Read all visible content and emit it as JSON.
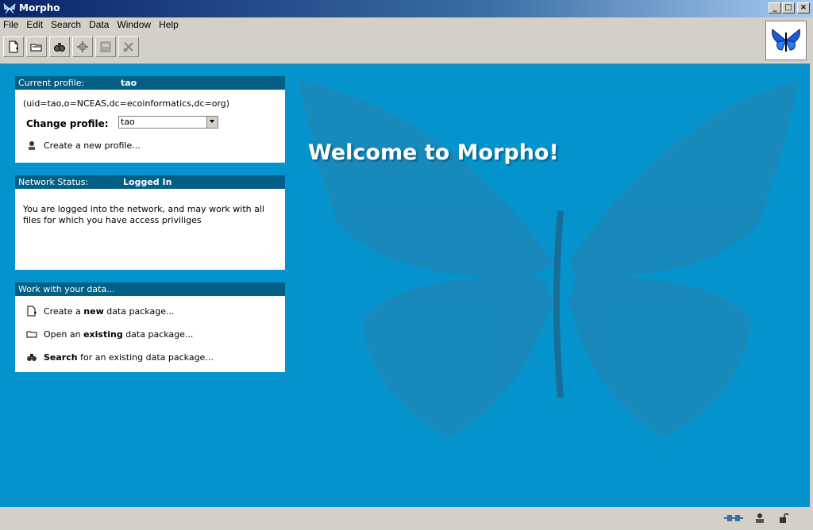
{
  "window": {
    "title": "Morpho"
  },
  "menu": [
    "File",
    "Edit",
    "Search",
    "Data",
    "Window",
    "Help"
  ],
  "toolbar": {
    "icons": [
      "new-package-icon",
      "open-package-icon",
      "search-icon",
      "settings-icon",
      "save-icon",
      "close-package-icon"
    ]
  },
  "welcome": "Welcome to Morpho!",
  "profile": {
    "header_label": "Current profile:",
    "header_value": "tao",
    "dn": "(uid=tao,o=NCEAS,dc=ecoinformatics,dc=org)",
    "change_label": "Change profile:",
    "selected": "tao",
    "create_link": "Create a new profile..."
  },
  "network": {
    "header_label": "Network Status:",
    "header_value": "Logged In",
    "message_line1": "You are logged into the network, and may work with all",
    "message_line2": "files for which you have access priviliges"
  },
  "data_panel": {
    "header_label": "Work with your data...",
    "create_pre": "Create a ",
    "create_bold": "new",
    "create_post": " data package...",
    "open_pre": "Open an ",
    "open_bold": "existing",
    "open_post": " data package...",
    "search_bold": "Search",
    "search_post": " for an existing data package..."
  },
  "colors": {
    "main_bg": "#0493cc",
    "header_bg": "#035f85",
    "chrome": "#d4d0c8"
  }
}
